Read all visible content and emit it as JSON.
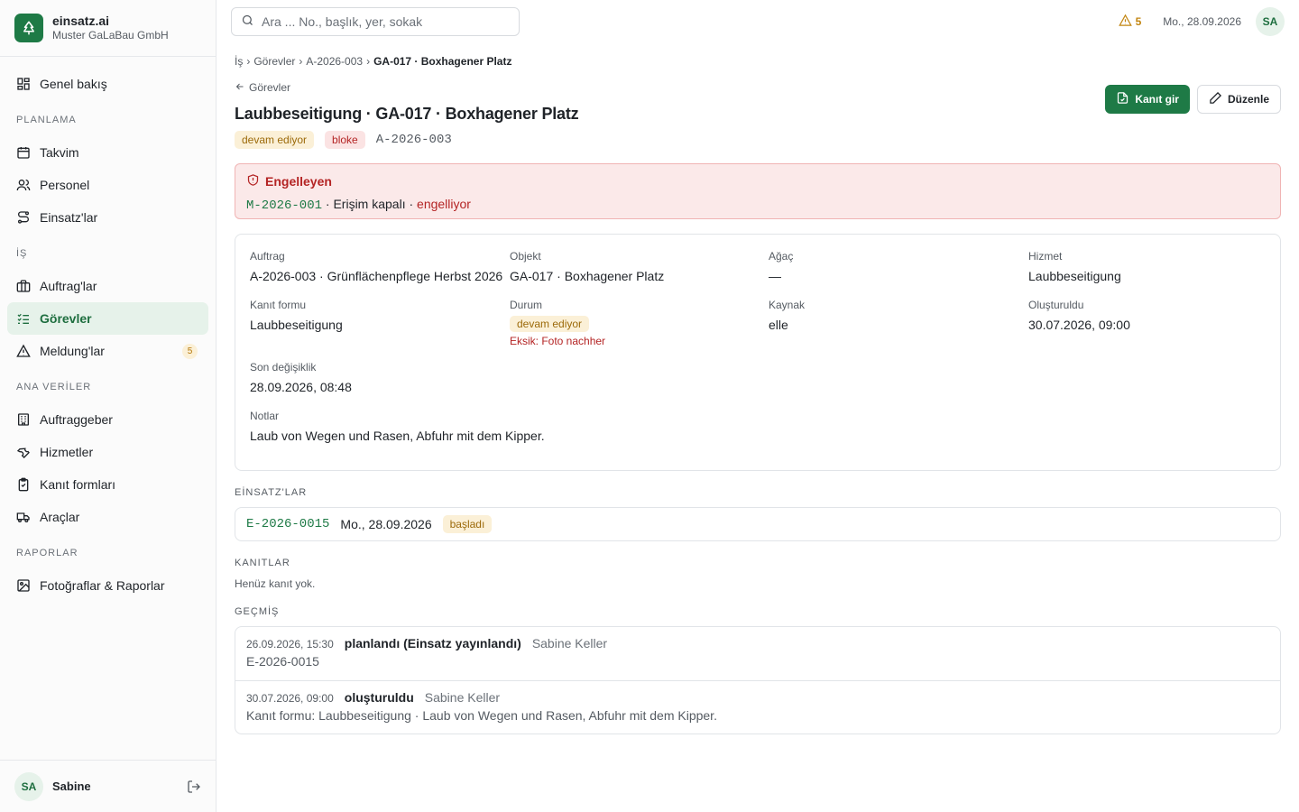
{
  "brand": {
    "name": "einsatz.ai",
    "company": "Muster GaLaBau GmbH",
    "logo_icon": "tree-icon",
    "color": "#1e7a46"
  },
  "nav": {
    "overview": "Genel bakış",
    "section_planning": "PLANLAMA",
    "calendar": "Takvim",
    "staff": "Personel",
    "einsaetze": "Einsatz'lar",
    "section_work": "İŞ",
    "auftraege": "Auftrag'lar",
    "tasks": "Görevler",
    "meldungen": "Meldung'lar",
    "meldungen_count": "5",
    "section_master": "ANA VERİLER",
    "clients": "Auftraggeber",
    "services": "Hizmetler",
    "forms": "Kanıt formları",
    "vehicles": "Araçlar",
    "section_reports": "RAPORLAR",
    "photos": "Fotoğraflar & Raporlar"
  },
  "user": {
    "initials": "SA",
    "name": "Sabine"
  },
  "search": {
    "placeholder": "Ara ... No., başlık, yer, sokak",
    "value": ""
  },
  "topbar": {
    "alert_count": "5",
    "date": "Mo., 28.09.2026",
    "initials": "SA"
  },
  "breadcrumb": {
    "root": "İş",
    "tasks": "Görevler",
    "auftrag": "A-2026-003",
    "current": "GA-017 · Boxhagener Platz"
  },
  "header": {
    "back_label": "Görevler",
    "title": "Laubbeseitigung · GA-017 · Boxhagener Platz",
    "status_pill": "devam ediyor",
    "blocked_pill": "bloke",
    "auftrag_ref": "A-2026-003",
    "primary_button": "Kanıt gir",
    "edit_button": "Düzenle"
  },
  "blocker": {
    "title": "Engelleyen",
    "ref": "M-2026-001",
    "text": "· Erişim kapalı ·",
    "status": "engelliyor"
  },
  "details": {
    "auftrag_label": "Auftrag",
    "auftrag_value": "A-2026-003 · Grünflächenpflege Herbst 2026",
    "objekt_label": "Objekt",
    "objekt_value": "GA-017 · Boxhagener Platz",
    "tree_label": "Ağaç",
    "tree_value": "—",
    "service_label": "Hizmet",
    "service_value": "Laubbeseitigung",
    "form_label": "Kanıt formu",
    "form_value": "Laubbeseitigung",
    "status_label": "Durum",
    "status_value": "devam ediyor",
    "status_missing": "Eksik: Foto nachher",
    "source_label": "Kaynak",
    "source_value": "elle",
    "created_label": "Oluşturuldu",
    "created_value": "30.07.2026, 09:00",
    "modified_label": "Son değişiklik",
    "modified_value": "28.09.2026, 08:48",
    "notes_label": "Notlar",
    "notes_value": "Laub von Wegen und Rasen, Abfuhr mit dem Kipper."
  },
  "einsaetze": {
    "title": "EİNSATZ'LAR",
    "items": [
      {
        "ref": "E-2026-0015",
        "date": "Mo., 28.09.2026",
        "status": "başladı"
      }
    ]
  },
  "evidence": {
    "title": "KANITLAR",
    "empty": "Henüz kanıt yok."
  },
  "history": {
    "title": "GEÇMİŞ",
    "items": [
      {
        "time": "26.09.2026, 15:30",
        "event": "planlandı (Einsatz yayınlandı)",
        "user": "Sabine Keller",
        "detail": "E-2026-0015"
      },
      {
        "time": "30.07.2026, 09:00",
        "event": "oluşturuldu",
        "user": "Sabine Keller",
        "detail": "Kanıt formu: Laubbeseitigung · Laub von Wegen und Rasen, Abfuhr mit dem Kipper."
      }
    ]
  }
}
